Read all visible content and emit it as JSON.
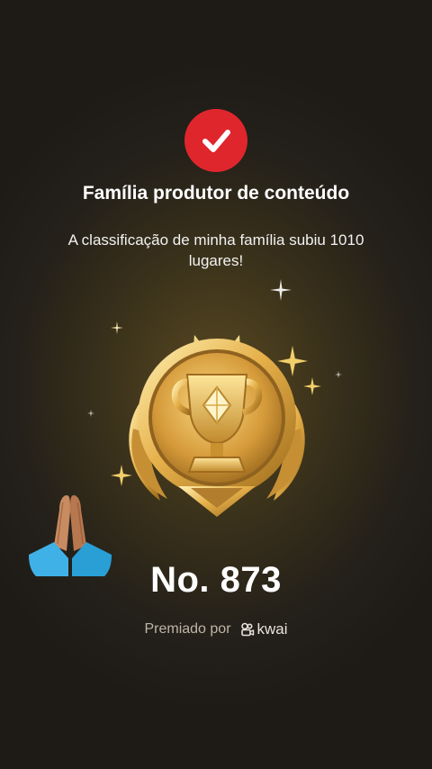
{
  "header": {
    "title": "Família produtor de conteúdo",
    "message": "A classificação de minha família subiu 1010 lugares!"
  },
  "badge": {
    "icon": "check-icon",
    "color": "#e0262d"
  },
  "trophy": {
    "icon": "gold-trophy-icon"
  },
  "reaction": {
    "icon": "praying-hands-emoji"
  },
  "rank": {
    "text": "No. 873"
  },
  "footer": {
    "awarded_by_label": "Premiado por",
    "brand_name": "kwai",
    "brand_icon": "kwai-logo-icon"
  }
}
